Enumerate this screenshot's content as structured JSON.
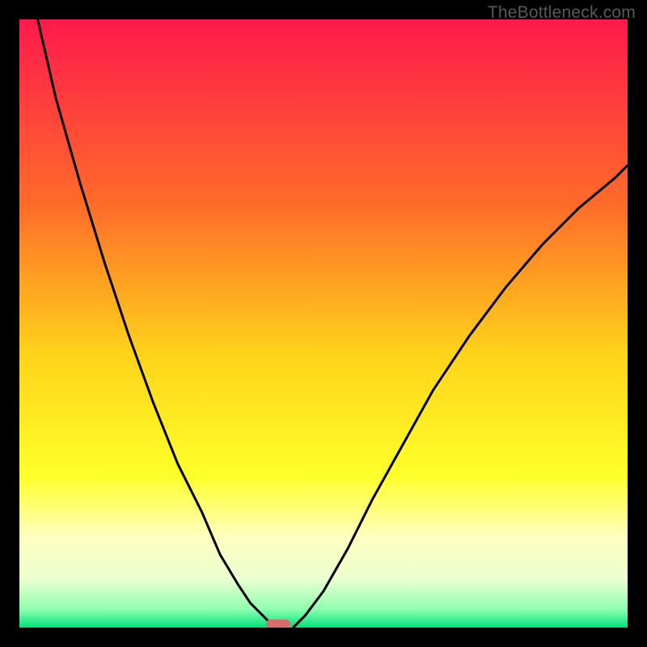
{
  "watermark": "TheBottleneck.com",
  "chart_data": {
    "type": "line",
    "title": "",
    "xlabel": "",
    "ylabel": "",
    "xlim": [
      0,
      100
    ],
    "ylim": [
      0,
      100
    ],
    "gradient_stops": [
      {
        "offset": 0,
        "color": "#ff1a4c"
      },
      {
        "offset": 30,
        "color": "#ff6a2a"
      },
      {
        "offset": 55,
        "color": "#ffd31a"
      },
      {
        "offset": 75,
        "color": "#ffff2a"
      },
      {
        "offset": 85,
        "color": "#ffffbf"
      },
      {
        "offset": 92,
        "color": "#ecffd0"
      },
      {
        "offset": 97,
        "color": "#8dffb0"
      },
      {
        "offset": 100,
        "color": "#00e37a"
      }
    ],
    "series": [
      {
        "name": "left-curve",
        "x": [
          3,
          6,
          10,
          14,
          18,
          22,
          26,
          30,
          33,
          36,
          38,
          40,
          41,
          42
        ],
        "y": [
          100,
          87,
          73,
          60,
          48,
          37,
          27,
          19,
          12,
          7,
          4,
          2,
          1,
          0
        ]
      },
      {
        "name": "right-curve",
        "x": [
          45,
          47,
          50,
          54,
          58,
          63,
          68,
          74,
          80,
          86,
          92,
          98,
          100
        ],
        "y": [
          0,
          2,
          6,
          13,
          21,
          30,
          39,
          48,
          56,
          63,
          69,
          74,
          76
        ]
      }
    ],
    "marker": {
      "x": 42.5,
      "y": 0,
      "width": 4,
      "height": 1.3,
      "color": "#d96b6b"
    }
  }
}
